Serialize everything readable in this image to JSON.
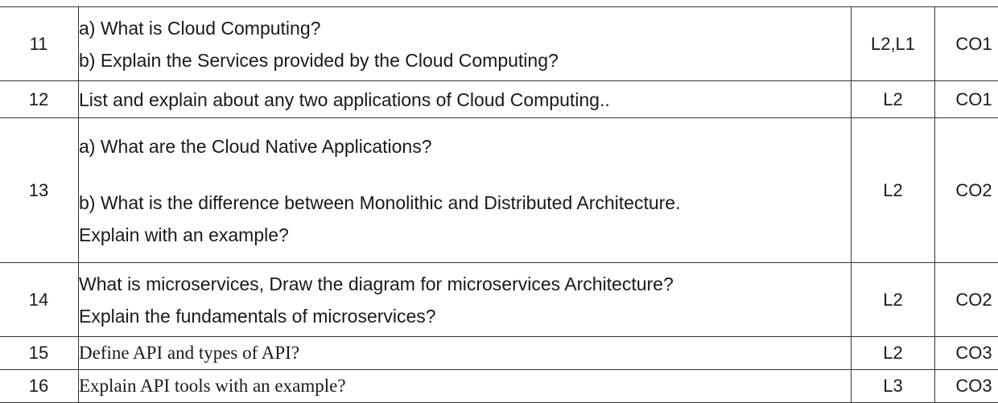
{
  "rows": [
    {
      "number": "11",
      "lines": [
        "a) What is Cloud Computing?",
        "b) Explain the Services provided by the Cloud Computing?"
      ],
      "level": "L2,L1",
      "co": "CO1"
    },
    {
      "number": "12",
      "lines": [
        "List and explain about any two applications of Cloud Computing.."
      ],
      "level": "L2",
      "co": "CO1"
    },
    {
      "number": "13",
      "lines": [
        "a) What are the Cloud Native Applications?",
        "b) What is the difference between Monolithic and Distributed Architecture.",
        "Explain with an example?"
      ],
      "level": "L2",
      "co": "CO2"
    },
    {
      "number": "14",
      "lines": [
        "What is microservices, Draw the diagram for microservices Architecture?",
        "Explain the fundamentals of microservices?"
      ],
      "level": "L2",
      "co": "CO2"
    },
    {
      "number": "15",
      "lines": [
        "Define API and types of API?"
      ],
      "level": "L2",
      "co": "CO3"
    },
    {
      "number": "16",
      "lines": [
        "Explain API tools with an example?"
      ],
      "level": "L3",
      "co": "CO3"
    }
  ]
}
